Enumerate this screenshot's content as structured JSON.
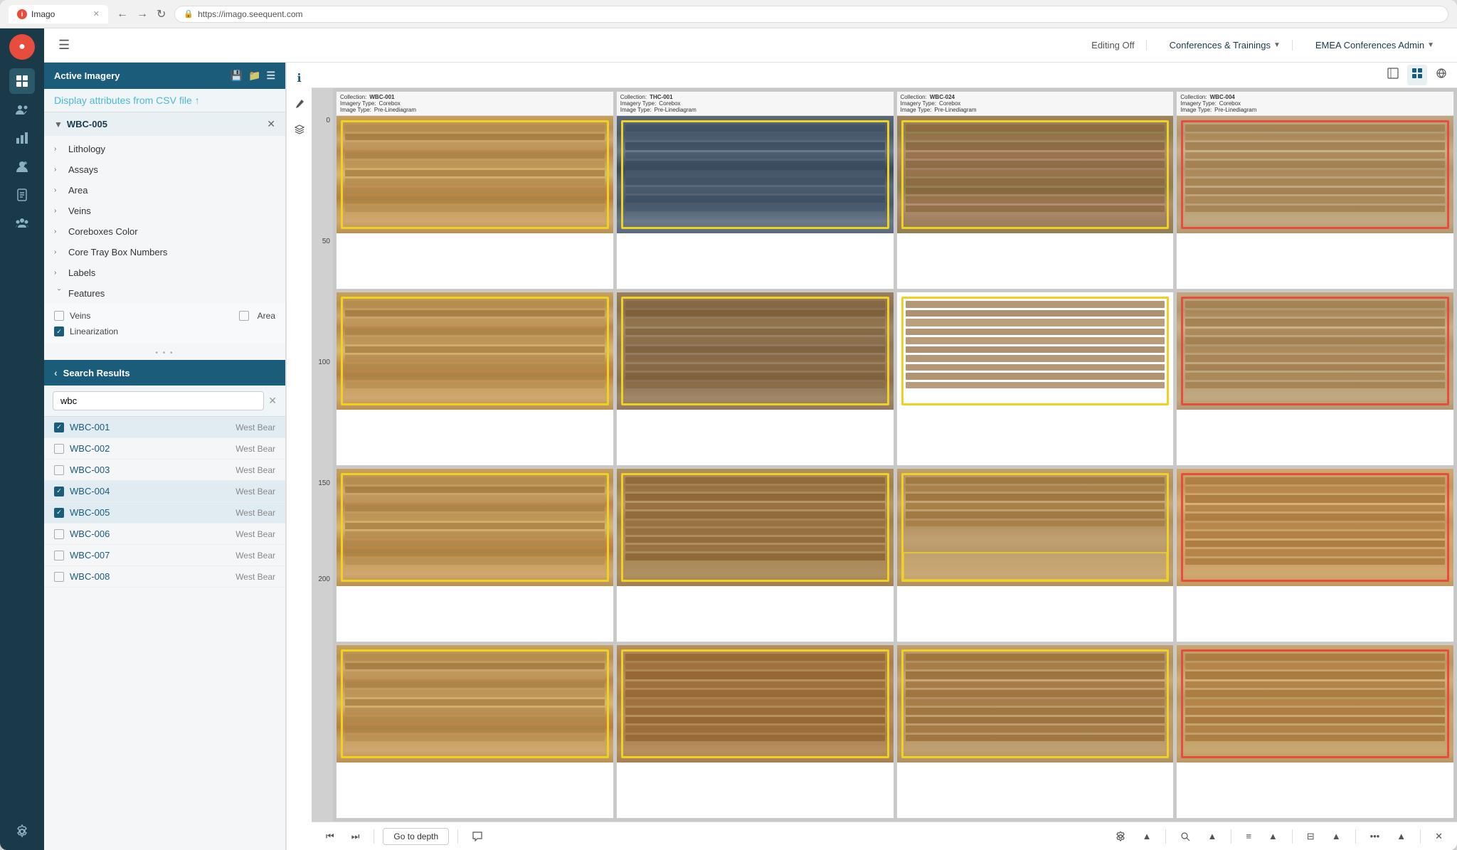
{
  "browser": {
    "tab_title": "Imago",
    "url": "https://imago.seequent.com",
    "favicon_letter": "i"
  },
  "header": {
    "hamburger_label": "☰",
    "editing_off": "Editing Off",
    "conferences_label": "Conferences & Trainings",
    "admin_label": "EMEA Conferences Admin"
  },
  "sidebar": {
    "icons": [
      {
        "name": "home",
        "glyph": "⊞",
        "active": true
      },
      {
        "name": "users",
        "glyph": "👥"
      },
      {
        "name": "chart",
        "glyph": "📊"
      },
      {
        "name": "person-settings",
        "glyph": "👤"
      },
      {
        "name": "report",
        "glyph": "📋"
      },
      {
        "name": "team",
        "glyph": "👥"
      },
      {
        "name": "settings",
        "glyph": "🔧"
      }
    ]
  },
  "active_imagery": {
    "title": "Active Imagery",
    "csv_link": "Display attributes from CSV file",
    "wbc_label": "WBC-005",
    "tree_items": [
      {
        "label": "Lithology",
        "expanded": false
      },
      {
        "label": "Assays",
        "expanded": false
      },
      {
        "label": "Area",
        "expanded": false
      },
      {
        "label": "Veins",
        "expanded": false
      },
      {
        "label": "Coreboxes Color",
        "expanded": false
      },
      {
        "label": "Core Tray Box Numbers",
        "expanded": false
      },
      {
        "label": "Labels",
        "expanded": false
      },
      {
        "label": "Features",
        "expanded": true
      }
    ],
    "features": [
      {
        "label": "Veins",
        "checked": false
      },
      {
        "label": "Area",
        "checked": false
      },
      {
        "label": "Linearization",
        "checked": true
      }
    ]
  },
  "search_results": {
    "title": "Search Results",
    "search_value": "wbc",
    "items": [
      {
        "id": "WBC-001",
        "location": "West Bear",
        "checked": true
      },
      {
        "id": "WBC-002",
        "location": "West Bear",
        "checked": false
      },
      {
        "id": "WBC-003",
        "location": "West Bear",
        "checked": false
      },
      {
        "id": "WBC-004",
        "location": "West Bear",
        "checked": true
      },
      {
        "id": "WBC-005",
        "location": "West Bear",
        "checked": true
      },
      {
        "id": "WBC-006",
        "location": "West Bear",
        "checked": false
      },
      {
        "id": "WBC-007",
        "location": "West Bear",
        "checked": false
      },
      {
        "id": "WBC-008",
        "location": "West Bear",
        "checked": false
      }
    ]
  },
  "right_tools": [
    "ℹ",
    "✏",
    "≡"
  ],
  "image_toolbar": {
    "icons": [
      "🖼",
      "⊞",
      "🌐"
    ]
  },
  "bottom_toolbar": {
    "prev_prev": "⏮",
    "prev": "⏭",
    "goto_depth": "Go to depth",
    "comment": "💬",
    "settings": "⚙",
    "up": "▲",
    "zoom": "🔍",
    "up2": "▲",
    "list": "≡",
    "up3": "▲",
    "stack": "⊟",
    "up4": "▲",
    "more": "•••",
    "up5": "▲",
    "close": "✕"
  },
  "depth_labels": [
    "0",
    "50",
    "100",
    "150",
    "200"
  ],
  "images": [
    {
      "collection": "WBC-001",
      "imagery_type": "Corebox",
      "image_type": "Pre-Linediagram",
      "style": "brown"
    },
    {
      "collection": "THC-001",
      "imagery_type": "Corebox",
      "image_type": "Pre-Linediagram",
      "style": "blue"
    },
    {
      "collection": "WBC-024",
      "imagery_type": "Corebox",
      "image_type": "Pre-Linediagram",
      "style": "brown"
    },
    {
      "collection": "WBC-004",
      "imagery_type": "Corebox",
      "image_type": "Pre-Linediagram",
      "style": "tan"
    }
  ]
}
